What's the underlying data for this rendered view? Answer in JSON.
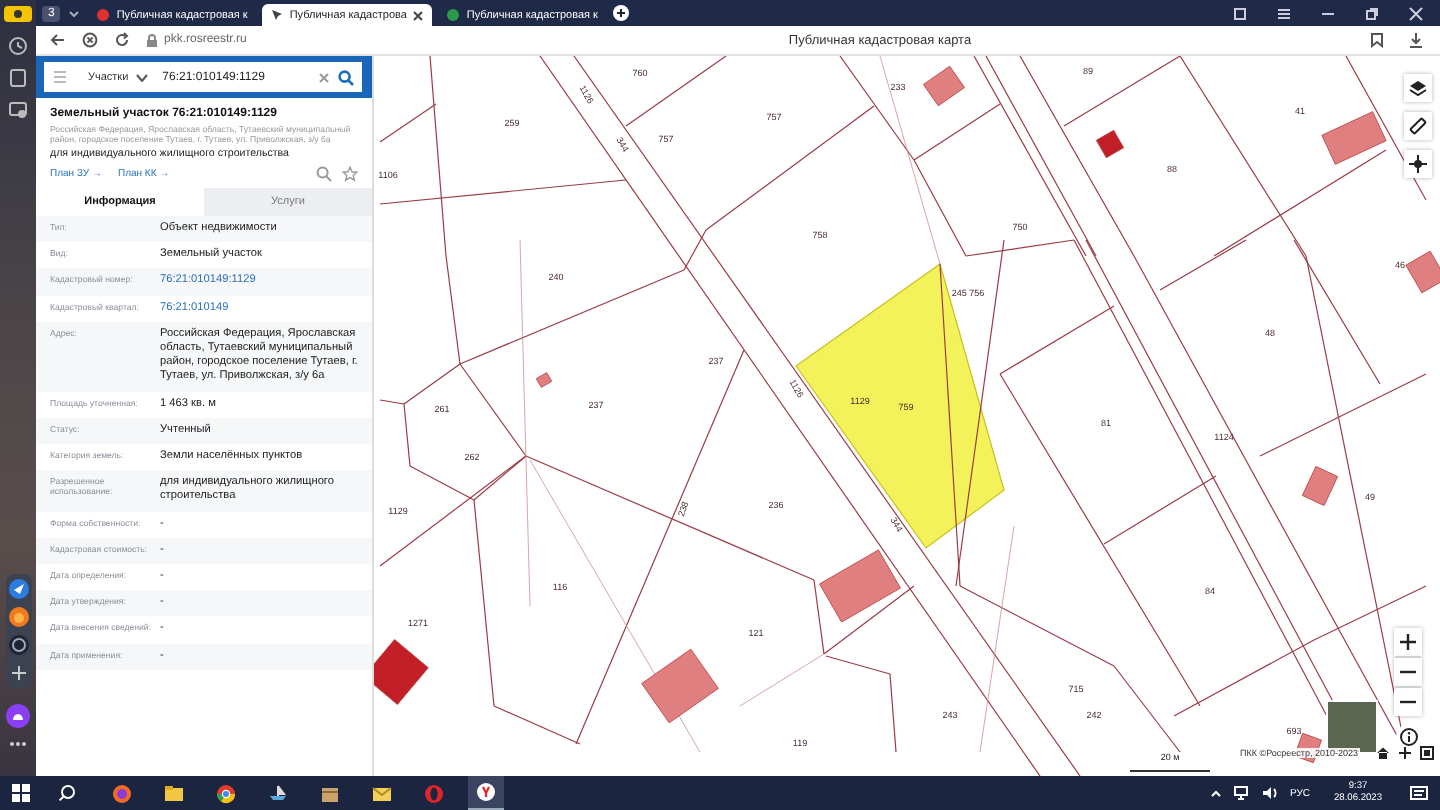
{
  "browser": {
    "tab_counter": "3",
    "tabs": [
      {
        "title": "Публичная кадастровая к",
        "selected": false
      },
      {
        "title": "Публичная кадастрова",
        "selected": true
      },
      {
        "title": "Публичная кадастровая к",
        "selected": false
      }
    ],
    "address": "pkk.rosreestr.ru",
    "page_title": "Публичная кадастровая карта"
  },
  "search": {
    "category": "Участки",
    "value": "76:21:010149:1129"
  },
  "parcel": {
    "title": "Земельный участок 76:21:010149:1129",
    "address": "Российская Федерация, Ярославская область, Тутаевский муниципальный район, городское поселение Тутаев, г. Тутаев, ул. Приволжская, з/у 6а",
    "use": "для индивидуального жилищного строительства",
    "links": [
      "План ЗУ →",
      "План КК →"
    ]
  },
  "tabs": [
    {
      "label": "Информация",
      "selected": true
    },
    {
      "label": "Услуги",
      "selected": false
    }
  ],
  "fields": [
    {
      "label": "Тип:",
      "value": "Объект недвижимости",
      "kind": "text"
    },
    {
      "label": "Вид:",
      "value": "Земельный участок",
      "kind": "text"
    },
    {
      "label": "Кадастровый номер:",
      "value": "76:21:010149:1129",
      "kind": "link"
    },
    {
      "label": "Кадастровый квартал:",
      "value": "76:21:010149",
      "kind": "link"
    },
    {
      "label": "Адрес:",
      "value": "Российская Федерация, Ярославская область, Тутаевский муниципальный район, городское поселение Тутаев, г. Тутаев, ул. Приволжская, з/у 6а",
      "kind": "text"
    },
    {
      "label": "Площадь уточненная:",
      "value": "1 463 кв. м",
      "kind": "text"
    },
    {
      "label": "Статус:",
      "value": "Учтенный",
      "kind": "text"
    },
    {
      "label": "Категория земель:",
      "value": "Земли населённых пунктов",
      "kind": "text"
    },
    {
      "label": "Разрешенное использование:",
      "value": "для индивидуального жилищного строительства",
      "kind": "text"
    },
    {
      "label": "Форма собственности:",
      "value": "-",
      "kind": "text"
    },
    {
      "label": "Кадастровая стоимость:",
      "value": "-",
      "kind": "text"
    },
    {
      "label": "Дата определения:",
      "value": "-",
      "kind": "text"
    },
    {
      "label": "Дата утверждения:",
      "value": "-",
      "kind": "text"
    },
    {
      "label": "Дата внесения сведений:",
      "value": "-",
      "kind": "text"
    },
    {
      "label": "Дата применения:",
      "value": "-",
      "kind": "text"
    }
  ],
  "map": {
    "parcel_numbers": [
      "1126",
      "760",
      "233",
      "89",
      "259",
      "344",
      "757",
      "757",
      "41",
      "1106",
      "88",
      "758",
      "750",
      "240",
      "245 756",
      "46",
      "48",
      "261",
      "237",
      "237",
      "1126",
      "1129",
      "759",
      "81",
      "262",
      "1124",
      "1129",
      "238",
      "236",
      "344",
      "49",
      "116",
      "84",
      "1271",
      "121",
      "715",
      "243",
      "242",
      "693",
      "119"
    ],
    "scale": "20 м",
    "copyright": "ПКК ©Росреестр, 2010-2023"
  },
  "taskbar": {
    "language": "РУС",
    "time": "9:37",
    "date": "28.06.2023"
  }
}
